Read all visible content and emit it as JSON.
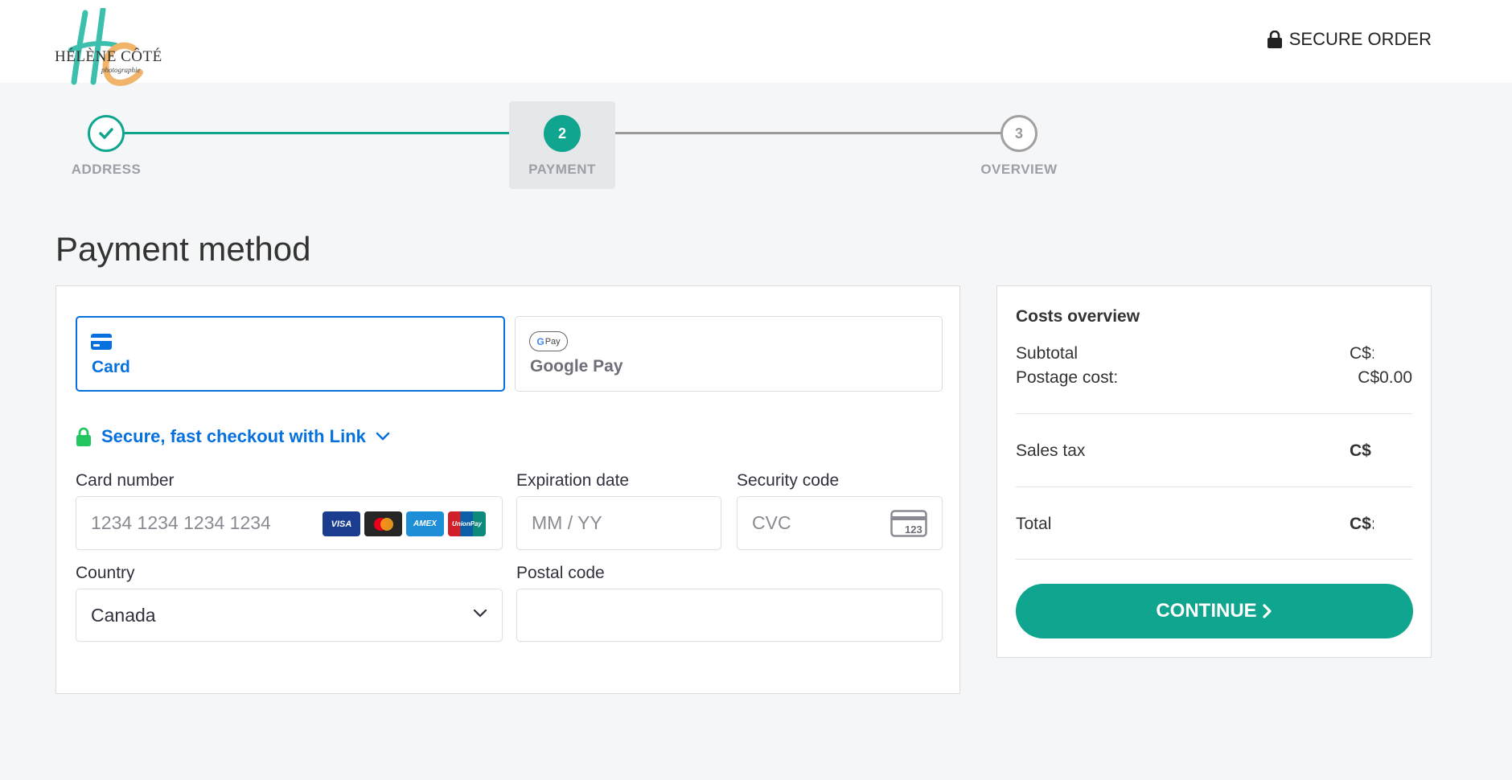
{
  "brand": {
    "name": "HÉLÈNE CÔTÉ",
    "sub": "photographie"
  },
  "header": {
    "secure_order": "SECURE ORDER"
  },
  "steps": [
    {
      "number": "",
      "label": "ADDRESS"
    },
    {
      "number": "2",
      "label": "PAYMENT"
    },
    {
      "number": "3",
      "label": "OVERVIEW"
    }
  ],
  "page_title": "Payment method",
  "methods": {
    "card": "Card",
    "gpay": "Google Pay",
    "gpay_badge": "Pay"
  },
  "link": {
    "text": "Secure, fast checkout with Link"
  },
  "form": {
    "card_number_label": "Card number",
    "card_number_placeholder": "1234 1234 1234 1234",
    "brands": {
      "visa": "VISA",
      "amex": "AMEX",
      "unionpay": "UnionPay"
    },
    "expiry_label": "Expiration date",
    "expiry_placeholder": "MM / YY",
    "cvc_label": "Security code",
    "cvc_placeholder": "CVC",
    "cvc_icon_text": "123",
    "country_label": "Country",
    "country_value": "Canada",
    "postal_label": "Postal code",
    "postal_value": ""
  },
  "costs": {
    "title": "Costs overview",
    "subtotal_label": "Subtotal",
    "subtotal_value": "C$:",
    "postage_label": "Postage cost:",
    "postage_value": "C$0.00",
    "tax_label": "Sales tax",
    "tax_value": "C$",
    "total_label": "Total",
    "total_value": "C$:",
    "continue": "CONTINUE"
  },
  "colors": {
    "accent": "#10a58f",
    "link_blue": "#0570de"
  }
}
